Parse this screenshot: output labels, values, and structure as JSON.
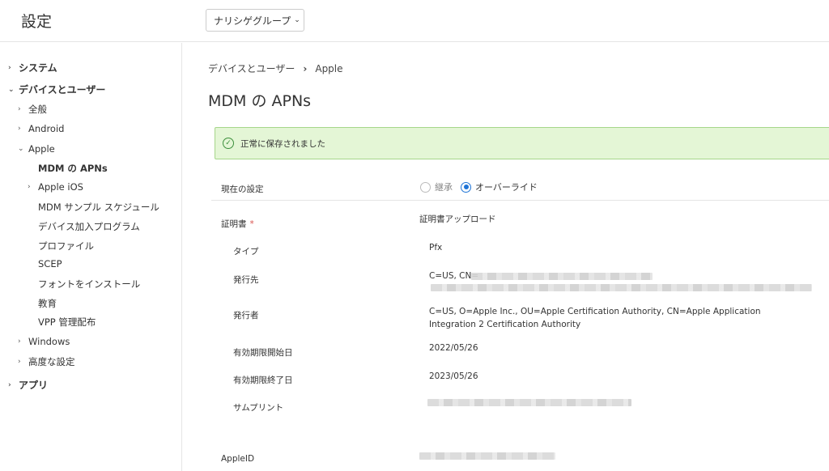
{
  "header": {
    "title": "設定",
    "group_select": "ナリシゲグループ"
  },
  "sidebar": {
    "items": [
      {
        "label": "システム"
      },
      {
        "label": "デバイスとユーザー"
      },
      {
        "label": "全般"
      },
      {
        "label": "Android"
      },
      {
        "label": "Apple"
      },
      {
        "label": "MDM の APNs"
      },
      {
        "label": "Apple iOS"
      },
      {
        "label": "MDM サンプル スケジュール"
      },
      {
        "label": "デバイス加入プログラム"
      },
      {
        "label": "プロファイル"
      },
      {
        "label": "SCEP"
      },
      {
        "label": "フォントをインストール"
      },
      {
        "label": "教育"
      },
      {
        "label": "VPP 管理配布"
      },
      {
        "label": "Windows"
      },
      {
        "label": "高度な設定"
      },
      {
        "label": "アプリ"
      }
    ]
  },
  "main": {
    "breadcrumb": {
      "parent": "デバイスとユーザー",
      "current": "Apple"
    },
    "title": "MDM の APNs",
    "alert": "正常に保存されました",
    "current_setting": {
      "label": "現在の設定",
      "options": [
        "継承",
        "オーバーライド"
      ],
      "selected": "オーバーライド"
    },
    "certificate": {
      "label": "証明書",
      "upload": "証明書アップロード",
      "type_label": "タイプ",
      "type_value": "Pfx",
      "issued_to_label": "発行先",
      "issued_to_value": "C=US, CN=",
      "issuer_label": "発行者",
      "issuer_value": "C=US, O=Apple Inc., OU=Apple Certification Authority, CN=Apple Application Integration 2 Certification Authority",
      "valid_from_label": "有効期限開始日",
      "valid_from_value": "2022/05/26",
      "valid_to_label": "有効期限終了日",
      "valid_to_value": "2023/05/26",
      "thumbprint_label": "サムプリント"
    },
    "apple_id_label": "AppleID"
  }
}
